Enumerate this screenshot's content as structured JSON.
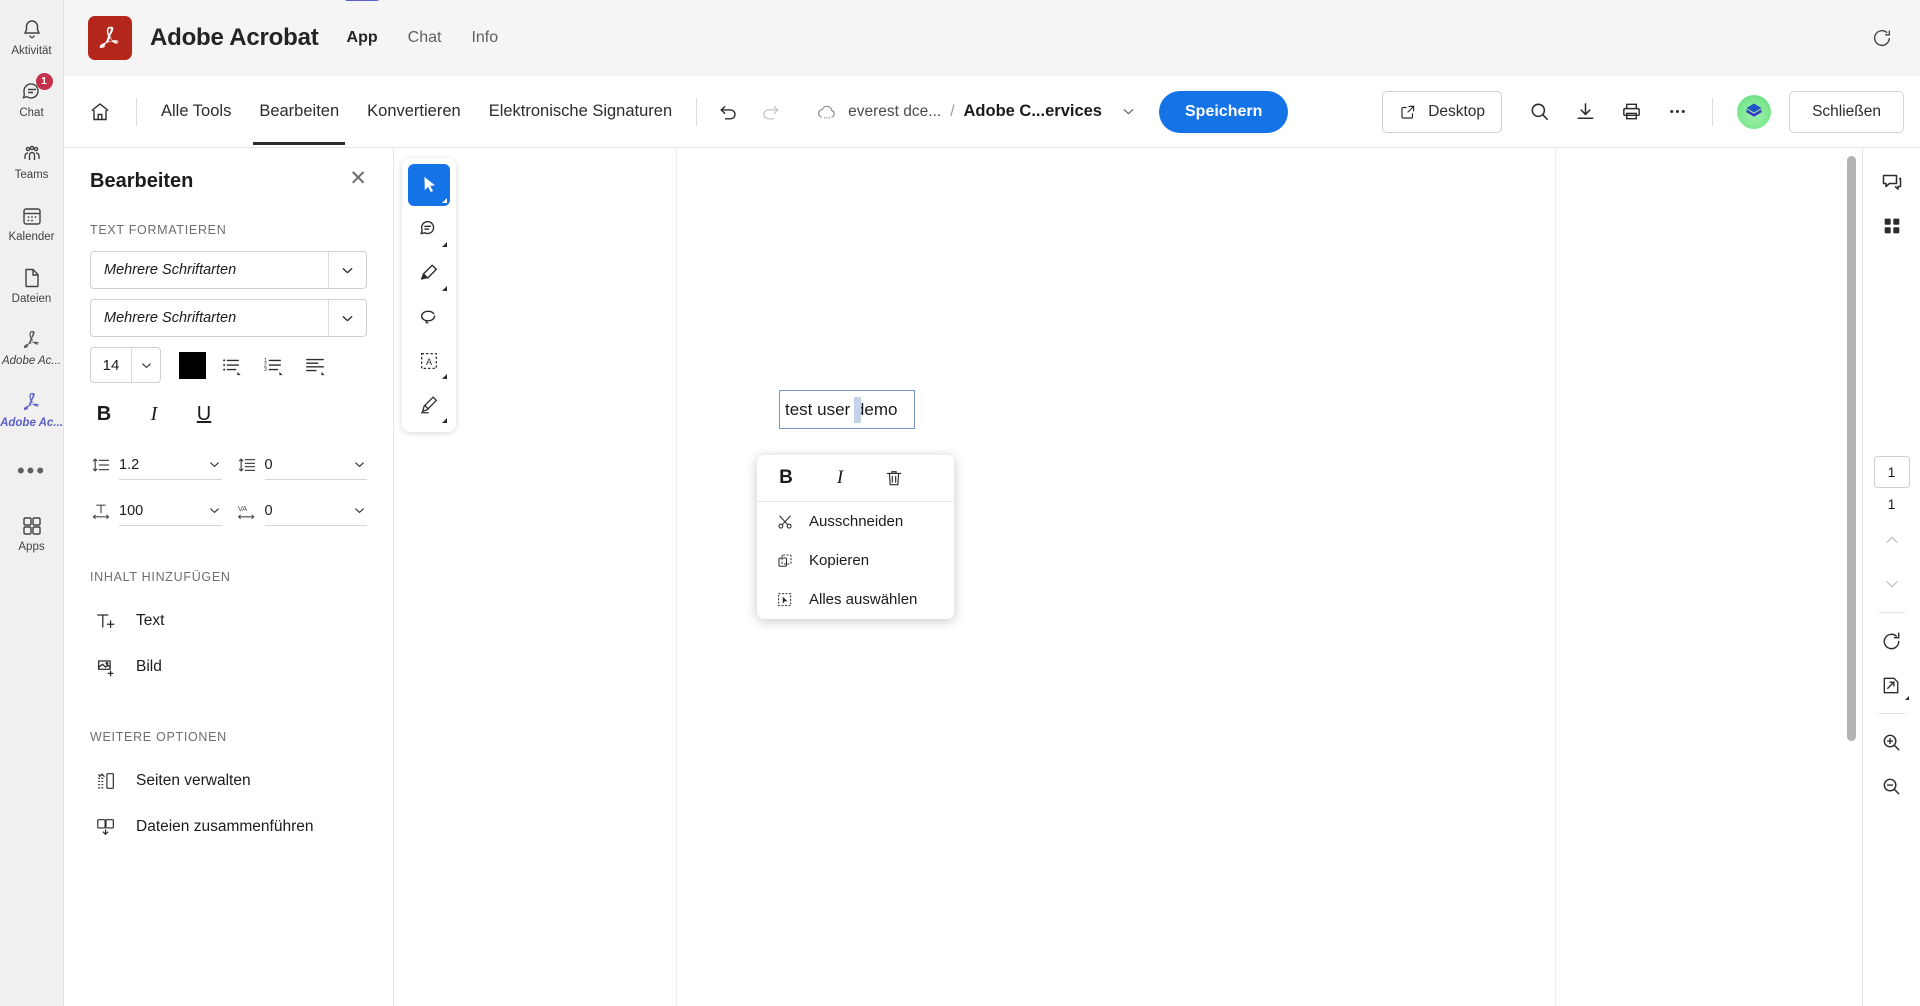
{
  "teams_rail": {
    "items": [
      {
        "label": "Aktivität",
        "icon": "bell-icon",
        "badge": null,
        "active": false
      },
      {
        "label": "Chat",
        "icon": "chat-icon",
        "badge": "1",
        "active": false
      },
      {
        "label": "Teams",
        "icon": "teams-icon",
        "badge": null,
        "active": false
      },
      {
        "label": "Kalender",
        "icon": "calendar-icon",
        "badge": null,
        "active": false
      },
      {
        "label": "Dateien",
        "icon": "files-icon",
        "badge": null,
        "active": false
      },
      {
        "label": "Adobe Ac...",
        "icon": "adobe-acrobat-icon",
        "badge": null,
        "active": false
      },
      {
        "label": "Adobe Ac...",
        "icon": "adobe-acrobat-icon",
        "badge": null,
        "active": true
      }
    ],
    "more_label": "•••",
    "apps": {
      "label": "Apps",
      "icon": "apps-grid-icon"
    }
  },
  "header": {
    "app_title": "Adobe Acrobat",
    "logo_icon": "adobe-acrobat-logo",
    "tabs": [
      {
        "label": "App",
        "selected": true
      },
      {
        "label": "Chat",
        "selected": false
      },
      {
        "label": "Info",
        "selected": false
      }
    ],
    "refresh_icon": "refresh-icon"
  },
  "acrobat_toolbar": {
    "home_icon": "home-icon",
    "tabs": [
      {
        "label": "Alle Tools",
        "selected": false
      },
      {
        "label": "Bearbeiten",
        "selected": true
      },
      {
        "label": "Konvertieren",
        "selected": false
      },
      {
        "label": "Elektronische Signaturen",
        "selected": false
      }
    ],
    "undo_icon": "undo-icon",
    "redo_icon": "redo-icon",
    "breadcrumb": {
      "cloud_icon": "cloud-icon",
      "account": "everest dce...",
      "separator": "/",
      "file": "Adobe C...ervices",
      "chevron_icon": "chevron-down-icon"
    },
    "save_label": "Speichern",
    "save_color": "#1473e6",
    "desktop_label": "Desktop",
    "desktop_icon": "open-external-icon",
    "search_icon": "search-icon",
    "download_icon": "download-icon",
    "print_icon": "print-icon",
    "more_icon": "more-horizontal-icon",
    "avatar_icon": "user-avatar",
    "close_label": "Schließen"
  },
  "edit_panel": {
    "title": "Bearbeiten",
    "close_icon": "close-icon",
    "section_text_format": "TEXT FORMATIEREN",
    "font_family": "Mehrere Schriftarten",
    "font_style": "Mehrere Schriftarten",
    "font_size": "14",
    "color_hex": "#000000",
    "bullet_list_icon": "bullet-list-icon",
    "numbered_list_icon": "numbered-list-icon",
    "align_icon": "align-left-icon",
    "bold_label": "B",
    "italic_label": "I",
    "underline_label": "U",
    "spacing": [
      {
        "icon": "line-spacing-icon",
        "value": "1.2"
      },
      {
        "icon": "paragraph-spacing-icon",
        "value": "0"
      },
      {
        "icon": "horizontal-scale-icon",
        "value": "100"
      },
      {
        "icon": "letter-spacing-icon",
        "value": "0"
      }
    ],
    "section_add_content": "INHALT HINZUFÜGEN",
    "add_items": [
      {
        "label": "Text",
        "icon": "add-text-icon"
      },
      {
        "label": "Bild",
        "icon": "add-image-icon"
      }
    ],
    "section_more_options": "WEITERE OPTIONEN",
    "more_items": [
      {
        "label": "Seiten verwalten",
        "icon": "manage-pages-icon"
      },
      {
        "label": "Dateien zusammenführen",
        "icon": "merge-files-icon"
      }
    ]
  },
  "tool_strip": {
    "items": [
      {
        "icon": "select-cursor-icon",
        "active": true,
        "has_menu": true
      },
      {
        "icon": "comment-icon",
        "active": false,
        "has_menu": true
      },
      {
        "icon": "highlight-icon",
        "active": false,
        "has_menu": true
      },
      {
        "icon": "lasso-icon",
        "active": false,
        "has_menu": false
      },
      {
        "icon": "edit-text-box-icon",
        "active": false,
        "has_menu": true
      },
      {
        "icon": "sign-icon",
        "active": false,
        "has_menu": true
      }
    ]
  },
  "document": {
    "text_field_value": "test user demo",
    "selection_highlight": "#c5d3ea",
    "field_border": "#7a93c9"
  },
  "context_menu": {
    "format_buttons": [
      {
        "label": "B",
        "name": "bold",
        "icon": null
      },
      {
        "label": "I",
        "name": "italic",
        "icon": null
      },
      {
        "label": "",
        "name": "delete",
        "icon": "trash-icon"
      }
    ],
    "items": [
      {
        "label": "Ausschneiden",
        "icon": "scissors-icon"
      },
      {
        "label": "Kopieren",
        "icon": "copy-icon"
      },
      {
        "label": "Alles auswählen",
        "icon": "select-all-icon"
      }
    ]
  },
  "right_rail": {
    "top_items": [
      {
        "icon": "comment-panel-icon"
      },
      {
        "icon": "thumbnails-grid-icon"
      }
    ],
    "page_current": "1",
    "page_total": "1",
    "prev_icon": "chevron-up-icon",
    "next_icon": "chevron-down-icon",
    "rotate_icon": "rotate-cw-icon",
    "fit_page_icon": "fit-page-icon",
    "zoom_in_icon": "zoom-in-icon",
    "zoom_out_icon": "zoom-out-icon"
  }
}
